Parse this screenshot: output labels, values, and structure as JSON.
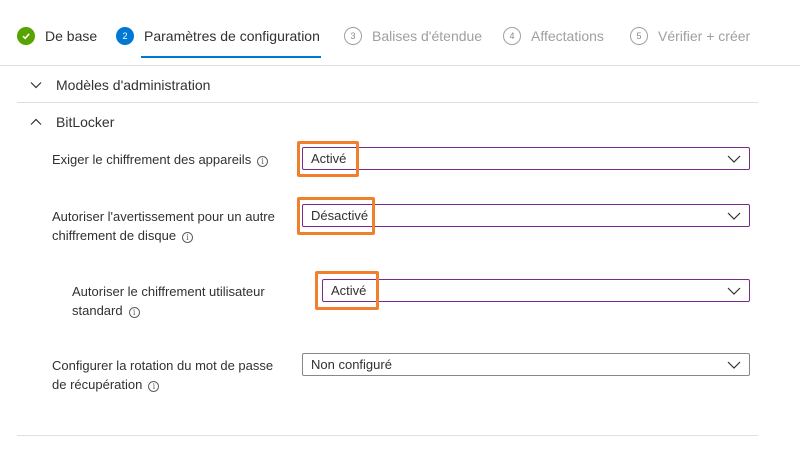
{
  "wizard": {
    "steps": [
      {
        "number": "",
        "label": "De base",
        "state": "done"
      },
      {
        "number": "2",
        "label": "Paramètres de configuration",
        "state": "current"
      },
      {
        "number": "3",
        "label": "Balises d'étendue",
        "state": "todo"
      },
      {
        "number": "4",
        "label": "Affectations",
        "state": "todo"
      },
      {
        "number": "5",
        "label": "Vérifier + créer",
        "state": "todo"
      }
    ]
  },
  "sections": {
    "admin_templates": {
      "title": "Modèles d'administration",
      "expanded": false
    },
    "bitlocker": {
      "title": "BitLocker",
      "expanded": true
    }
  },
  "settings": [
    {
      "label_line1": "Exiger le chiffrement des appareils",
      "label_line2": "",
      "value": "Activé",
      "highlighted": true
    },
    {
      "label_line1": "Autoriser l'avertissement pour un autre",
      "label_line2": "chiffrement de disque",
      "value": "Désactivé",
      "highlighted": true
    },
    {
      "label_line1": "Autoriser le chiffrement utilisateur",
      "label_line2": "standard",
      "value": "Activé",
      "highlighted": true
    },
    {
      "label_line1": "Configurer la rotation du mot de passe",
      "label_line2": "de récupération",
      "value": "Non configuré",
      "highlighted": false
    }
  ],
  "colors": {
    "accent": "#0078d4",
    "success": "#57a300",
    "highlight_box": "#f0802c",
    "focused_select_border": "#7a2a8a"
  }
}
